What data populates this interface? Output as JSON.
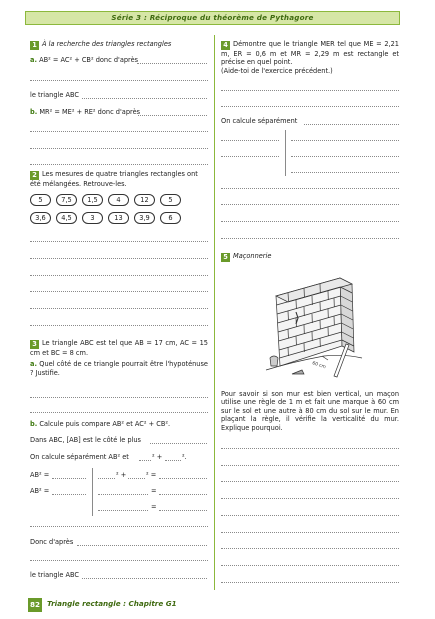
{
  "header": {
    "title": "Série 3 : Réciproque du théorème de Pythagore"
  },
  "ex1": {
    "num": "1",
    "title": "À la recherche des triangles rectangles",
    "a_label": "a.",
    "a_text": "AB² = AC² + CB² donc d'après",
    "a_concl": "le triangle ABC",
    "b_label": "b.",
    "b_text": "MR² = ME² + RE² donc d'après"
  },
  "ex2": {
    "num": "2",
    "text": "Les mesures de quatre triangles rectangles ont été mélangées. Retrouve-les.",
    "row1": [
      "5",
      "7,5",
      "1,5",
      "4",
      "12",
      "5"
    ],
    "row2": [
      "3,6",
      "4,5",
      "3",
      "13",
      "3,9",
      "6"
    ]
  },
  "ex3": {
    "num": "3",
    "text": "Le triangle ABC est tel que AB = 17 cm, AC = 15 cm et BC = 8 cm.",
    "a_label": "a.",
    "a_text": "Quel côté de ce triangle pourrait être l'hypoténuse ? Justifie.",
    "b_label": "b.",
    "b_text": "Calcule puis compare AB² et AC² + CB².",
    "line1": "Dans ABC, [AB] est le côté le plus",
    "line2": "On calcule séparément AB² et",
    "line2_end": "² +",
    "line2_end2": "².",
    "ab2_1": "AB² =",
    "ab2_2": "AB² =",
    "sum_sym": "² +",
    "sum_sym2": "² =",
    "eq1": "=",
    "eq2": "=",
    "donc": "Donc d'après",
    "concl": "le triangle ABC"
  },
  "ex4": {
    "num": "4",
    "text": "Démontre que le triangle MER tel que ME = 2,21 m, ER = 0,6 m et MR = 2,29 m est rectangle et précise en quel point.",
    "hint": "(Aide-toi de l'exercice précédent.)",
    "calc": "On calcule séparément"
  },
  "ex5": {
    "num": "5",
    "title": "Maçonnerie",
    "img_label": "60 cm",
    "text": "Pour savoir si son mur est bien vertical, un maçon utilise une règle de 1 m et fait une marque à 60 cm sur le sol et une autre à 80 cm du sol sur le mur. En plaçant la règle, il vérifie la verticalité du mur. Explique pourquoi."
  },
  "footer": {
    "page": "82",
    "title": "Triangle rectangle : Chapitre G1"
  }
}
